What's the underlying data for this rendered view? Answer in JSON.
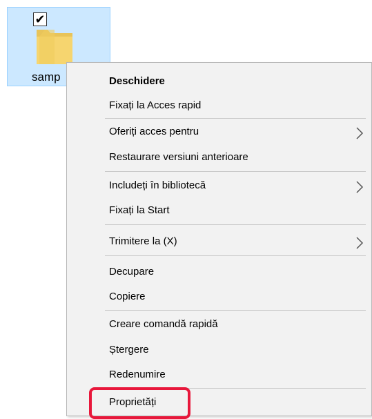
{
  "desktop": {
    "icon_label": "samp",
    "checkbox_mark": "✔",
    "icon_name": "folder-icon",
    "selection_color": "#cce8ff"
  },
  "context_menu": {
    "items": [
      {
        "label": "Deschidere",
        "bold": true
      },
      {
        "label": "Fixați la Acces rapid"
      },
      {
        "label": "Oferiți acces pentru",
        "submenu": true
      },
      {
        "label": "Restaurare versiuni anterioare"
      },
      {
        "label": "Includeți în bibliotecă",
        "submenu": true
      },
      {
        "label": "Fixați la Start"
      },
      {
        "label": "Trimitere la (X)",
        "submenu": true
      },
      {
        "label": "Decupare"
      },
      {
        "label": "Copiere"
      },
      {
        "label": "Creare comandă rapidă"
      },
      {
        "label": "Ștergere"
      },
      {
        "label": "Redenumire"
      },
      {
        "label": "Proprietăți",
        "highlighted": true
      }
    ],
    "highlight_color": "#e8173b"
  }
}
